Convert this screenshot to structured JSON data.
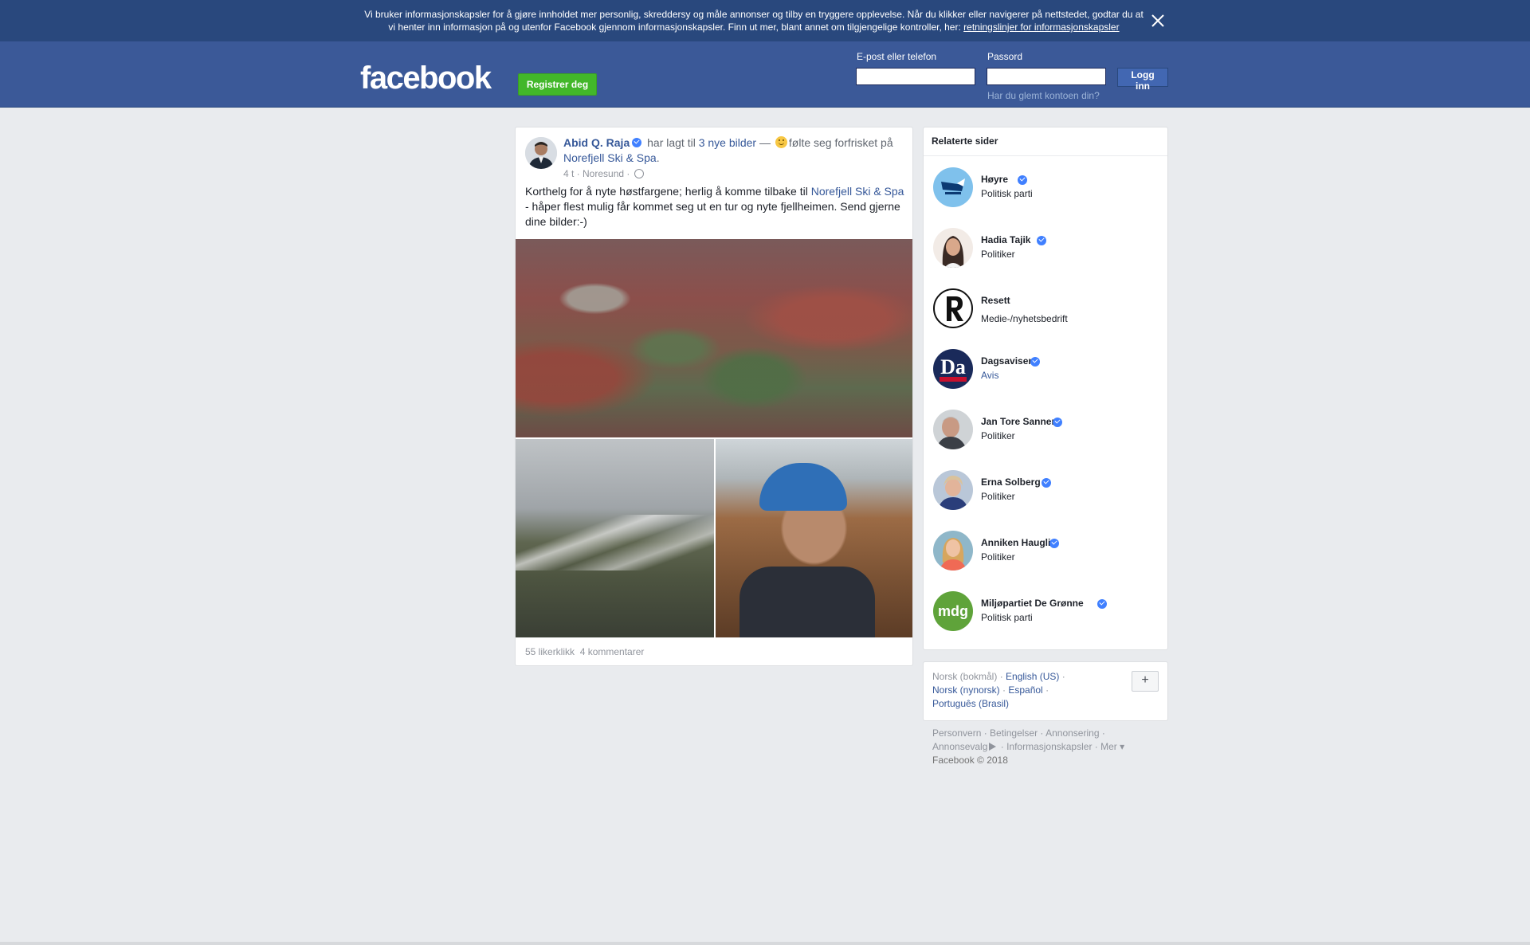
{
  "cookie": {
    "text": "Vi bruker informasjonskapsler for å gjøre innholdet mer personlig, skreddersy og måle annonser og tilby en tryggere opplevelse. Når du klikker eller navigerer på nettstedet, godtar du at vi henter inn informasjon på og utenfor Facebook gjennom informasjonskapsler. Finn ut mer, blant annet om tilgjengelige kontroller, her:",
    "link": "retningslinjer for informasjonskapsler"
  },
  "header": {
    "logo": "facebook",
    "register": "Registrer deg",
    "email_label": "E-post eller telefon",
    "password_label": "Passord",
    "login": "Logg inn",
    "forgot": "Har du glemt kontoen din?"
  },
  "post": {
    "author": "Abid Q. Raja",
    "added": "har lagt til",
    "photos_link": "3 nye bilder",
    "dash": "—",
    "feeling": "følte seg forfrisket",
    "at": "på",
    "place": "Norefjell Ski & Spa",
    "time": "4 t",
    "location": "Noresund",
    "text_before": "Korthelg for å nyte høstfargene; herlig å komme tilbake til",
    "text_link": "Norefjell Ski & Spa",
    "text_after": "- håper flest mulig får kommet seg ut en tur og nyte fjellheimen. Send gjerne dine bilder:-)",
    "likes": "55 likerklikk",
    "comments": "4 kommentarer"
  },
  "related": {
    "title": "Relaterte sider",
    "items": [
      {
        "name": "Høyre",
        "category": "Politisk parti"
      },
      {
        "name": "Hadia Tajik",
        "category": "Politiker"
      },
      {
        "name": "Resett",
        "category": "Medie-/nyhetsbedrift"
      },
      {
        "name": "Dagsavisen",
        "category": "Avis"
      },
      {
        "name": "Jan Tore Sanner",
        "category": "Politiker"
      },
      {
        "name": "Erna Solberg",
        "category": "Politiker"
      },
      {
        "name": "Anniken Hauglie",
        "category": "Politiker"
      },
      {
        "name": "Miljøpartiet De Grønne",
        "category": "Politisk parti"
      }
    ]
  },
  "languages": {
    "current": "Norsk (bokmål)",
    "english": "English (US)",
    "nynorsk": "Norsk (nynorsk)",
    "spanish": "Español",
    "portuguese": "Português (Brasil)",
    "plus": "+"
  },
  "footer": {
    "privacy": "Personvern",
    "terms": "Betingelser",
    "ads": "Annonsering",
    "adchoices": "Annonsevalg",
    "cookies": "Informasjonskapsler",
    "more": "Mer",
    "copyright": "Facebook © 2018"
  },
  "colors": {
    "header": "#3b5998",
    "cookie_bar": "#29487d",
    "register": "#42b72a",
    "link": "#365899",
    "verified": "#4080ff"
  }
}
